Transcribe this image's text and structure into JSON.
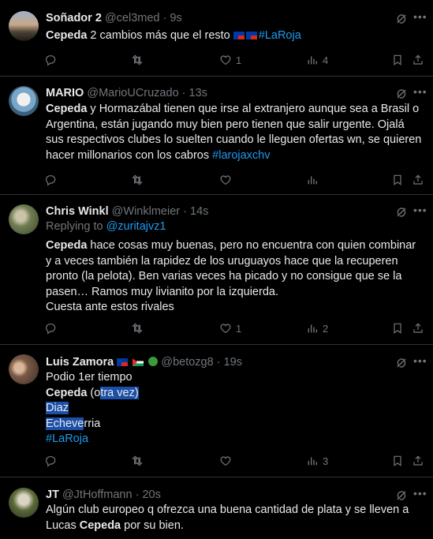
{
  "tweets": [
    {
      "name": "Soñador 2",
      "handle": "@cel3med",
      "time": "9s",
      "avatar": "sunset-avatar",
      "text_bold": "Cepeda",
      "text": " 2 cambios más que el resto ",
      "hashtag": "#LaRoja",
      "counts": {
        "reply": "",
        "retweet": "",
        "like": "1",
        "views": "4"
      }
    },
    {
      "name": "MARIO",
      "handle": "@MarioUCruzado",
      "time": "13s",
      "text_bold": "Cepeda",
      "text": " y Hormazábal tienen que irse al extranjero aunque sea a Brasil o Argentina, están jugando muy bien pero tienen que salir urgente. Ojalá sus respectivos clubes lo suelten cuando le lleguen ofertas wn, se quieren hacer millonarios con los cabros ",
      "hashtag": "#larojaxchv",
      "counts": {
        "reply": "",
        "retweet": "",
        "like": "",
        "views": ""
      }
    },
    {
      "name": "Chris Winkl",
      "handle": "@Winklmeier",
      "time": "14s",
      "replying_label": "Replying to ",
      "replying_to": "@zuritajvz1",
      "text_bold": "Cepeda",
      "text": " hace cosas muy buenas, pero no encuentra con quien combinar y a veces también la rapidez de los uruguayos hace que la recuperen pronto (la pelota). Ben varias veces ha picado y no consigue que se la pasen… Ramos muy livianito por la izquierda.",
      "text_line2": "Cuesta ante estos rivales",
      "counts": {
        "reply": "",
        "retweet": "",
        "like": "1",
        "views": "2"
      }
    },
    {
      "name": "Luis Zamora",
      "handle": "@betozg8",
      "time": "19s",
      "line1": "Podio 1er tiempo",
      "line2_bold": "Cepeda",
      "line2_a": " (o",
      "line2_b": "tra vez)",
      "line3": "Diaz",
      "line4_a": "Echeve",
      "line4_b": "rria",
      "hashtag": "#LaRoja",
      "counts": {
        "reply": "",
        "retweet": "",
        "like": "",
        "views": "3"
      }
    },
    {
      "name": "JT",
      "handle": "@JtHoffmann",
      "time": "20s",
      "text_a": "Algún club europeo q ofrezca una buena cantidad de plata y se lleven a Lucas ",
      "text_bold": "Cepeda",
      "text_b": " por su bien."
    }
  ],
  "separator": "·",
  "icons": [
    "reply-icon",
    "retweet-icon",
    "like-icon",
    "views-icon",
    "bookmark-icon",
    "share-icon",
    "grok-icon",
    "more-icon"
  ],
  "colors": {
    "background": "#000000",
    "text": "#e7e9ea",
    "muted": "#71767b",
    "link": "#1d9bf0",
    "highlight": "#1b4fa8"
  }
}
